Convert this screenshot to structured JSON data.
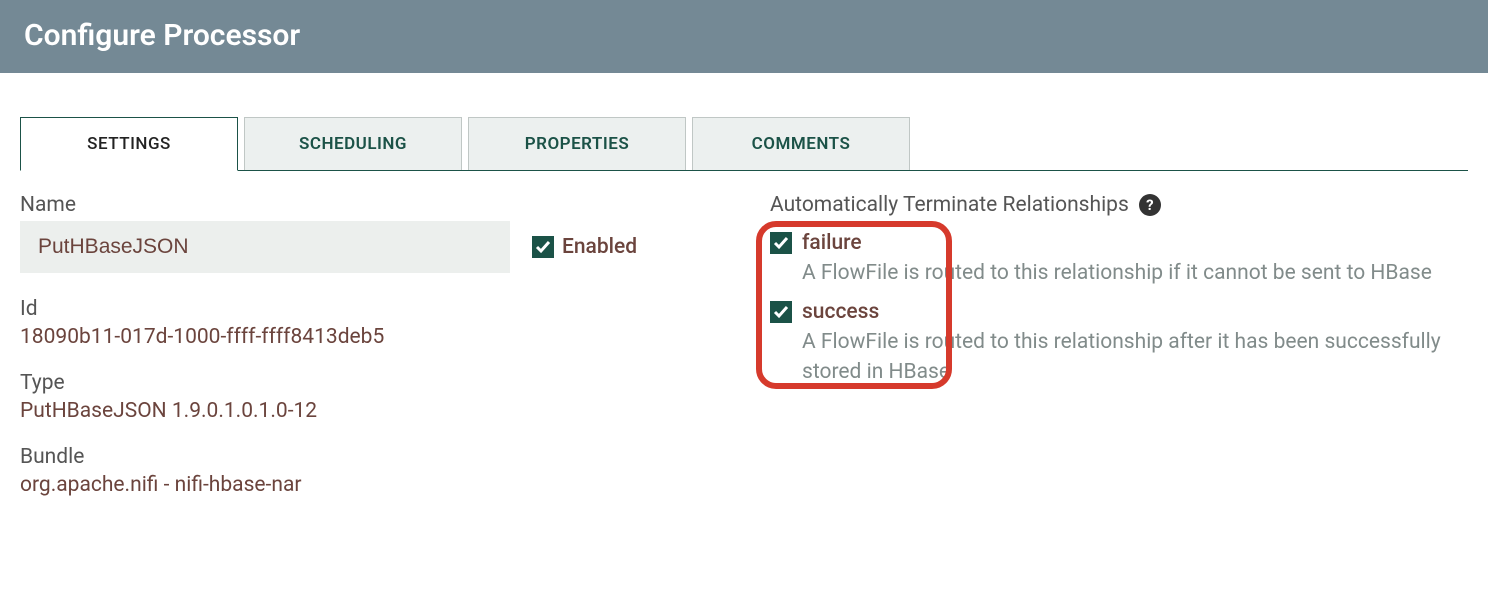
{
  "header": {
    "title": "Configure Processor"
  },
  "tabs": [
    {
      "label": "SETTINGS",
      "active": true
    },
    {
      "label": "SCHEDULING",
      "active": false
    },
    {
      "label": "PROPERTIES",
      "active": false
    },
    {
      "label": "COMMENTS",
      "active": false
    }
  ],
  "left": {
    "name_label": "Name",
    "name_value": "PutHBaseJSON",
    "enabled_label": "Enabled",
    "enabled_checked": true,
    "id_label": "Id",
    "id_value": "18090b11-017d-1000-ffff-ffff8413deb5",
    "type_label": "Type",
    "type_value": "PutHBaseJSON 1.9.0.1.0.1.0-12",
    "bundle_label": "Bundle",
    "bundle_value": "org.apache.nifi - nifi-hbase-nar"
  },
  "right": {
    "section_label": "Automatically Terminate Relationships",
    "relationships": [
      {
        "name": "failure",
        "checked": true,
        "description": "A FlowFile is routed to this relationship if it cannot be sent to HBase"
      },
      {
        "name": "success",
        "checked": true,
        "description": "A FlowFile is routed to this relationship after it has been successfully stored in HBase"
      }
    ]
  }
}
